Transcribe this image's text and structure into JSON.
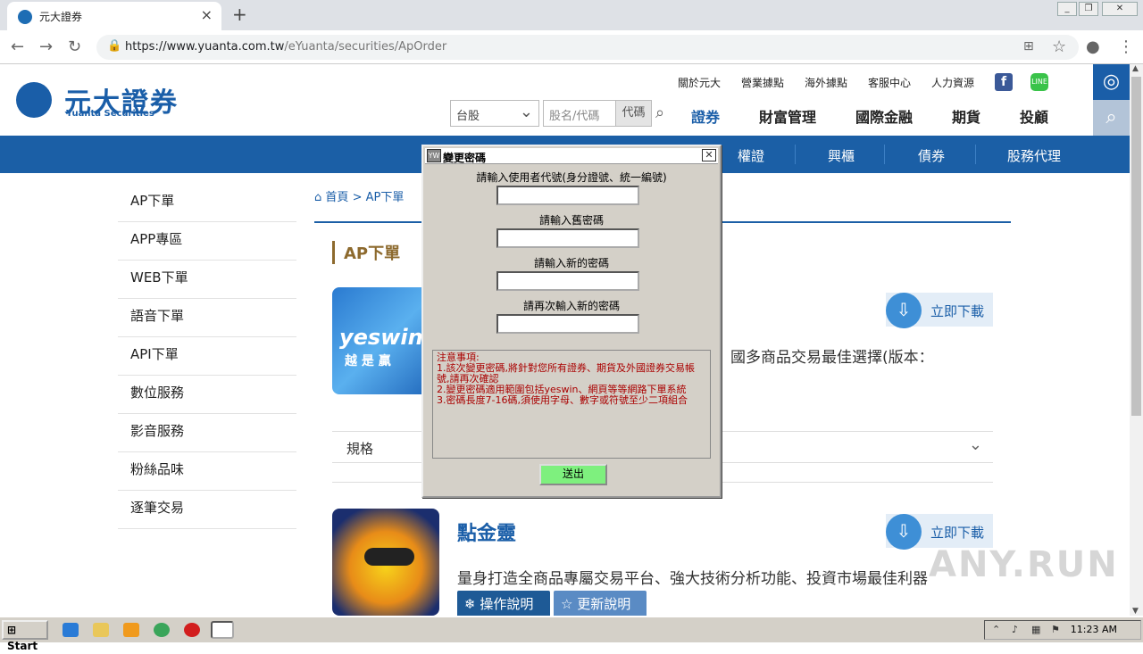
{
  "browser": {
    "tab_title": "元大證券",
    "url_host": "https://www.yuanta.com.tw",
    "url_path": "/eYuanta/securities/ApOrder"
  },
  "site": {
    "logo_text": "元大證券",
    "logo_sub": "Yuanta Securities",
    "top_links": [
      "關於元大",
      "營業據點",
      "海外據點",
      "客服中心",
      "人力資源"
    ],
    "market_select": "台股",
    "stock_placeholder": "股名/代碼",
    "code_button": "代碼",
    "main_nav": [
      "證券",
      "財富管理",
      "國際金融",
      "期貨",
      "投顧"
    ],
    "sub_nav": [
      "權證",
      "興櫃",
      "債券",
      "股務代理"
    ]
  },
  "sidebar": {
    "items": [
      "AP下單",
      "APP專區",
      "WEB下單",
      "語音下單",
      "API下單",
      "數位服務",
      "影音服務",
      "粉絲品味",
      "逐筆交易"
    ]
  },
  "breadcrumb": {
    "home": "首頁",
    "current": "AP下單"
  },
  "main": {
    "section_title": "AP下單",
    "app1": {
      "logo_text": "yeswin",
      "logo_sub": "越 是 贏",
      "download": "立即下載",
      "desc": "國多商品交易最佳選擇(版本：",
      "spec_label": "規格"
    },
    "app2": {
      "name": "點金靈",
      "download": "立即下載",
      "desc": "量身打造全商品專屬交易平台、強大技術分析功能、投資市場最佳利器",
      "guide_button": "操作說明",
      "update_button": "更新說明"
    }
  },
  "dialog": {
    "title": "變更密碼",
    "label_user": "請輸入使用者代號(身分證號、統一編號)",
    "label_old": "請輸入舊密碼",
    "label_new": "請輸入新的密碼",
    "label_confirm": "請再次輸入新的密碼",
    "notice_title": "注意事項:",
    "notice_1": "1.該次變更密碼,將針對您所有證券、期貨及外國證券交易帳號,請再次確認",
    "notice_2": "2.變更密碼適用範圍包括yeswin、網頁等等網路下單系統",
    "notice_3": "3.密碼長度7-16碼,須使用字母、數字或符號至少二項組合",
    "submit": "送出"
  },
  "watermark": "ANY.RUN",
  "taskbar": {
    "start": "Start",
    "clock": "11:23 AM"
  }
}
